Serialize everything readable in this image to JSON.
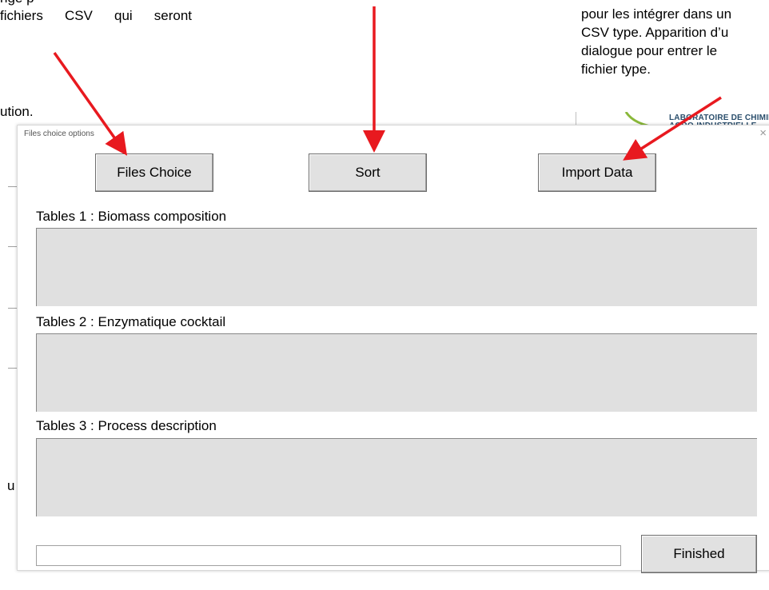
{
  "doc": {
    "left_line0": "ngé p",
    "left_line1_words": [
      "fichiers",
      "CSV",
      "qui",
      "seront"
    ],
    "right_lines": [
      "pour les intégrer dans un",
      "CSV type. Apparition d’u",
      "dialogue pour entrer le",
      "fichier type."
    ],
    "bg_word": "ution.",
    "bg_letter": "u",
    "logo_line1": "LABORATOIRE DE CHIMIE",
    "logo_line2": "AGRO-INDUSTRIELLE"
  },
  "dialog": {
    "title": "Files choice options",
    "close_icon": "×",
    "buttons": {
      "files_choice": "Files Choice",
      "sort": "Sort",
      "import_data": "Import Data",
      "finished": "Finished"
    },
    "tables": [
      {
        "label": "Tables 1 : Biomass composition"
      },
      {
        "label": "Tables 2 : Enzymatique cocktail"
      },
      {
        "label": "Tables 3 : Process description"
      }
    ],
    "progress_value": ""
  },
  "colors": {
    "arrow": "#e8191f",
    "button_bg": "#e1e1e1",
    "table_bg": "#e0e0e0"
  }
}
